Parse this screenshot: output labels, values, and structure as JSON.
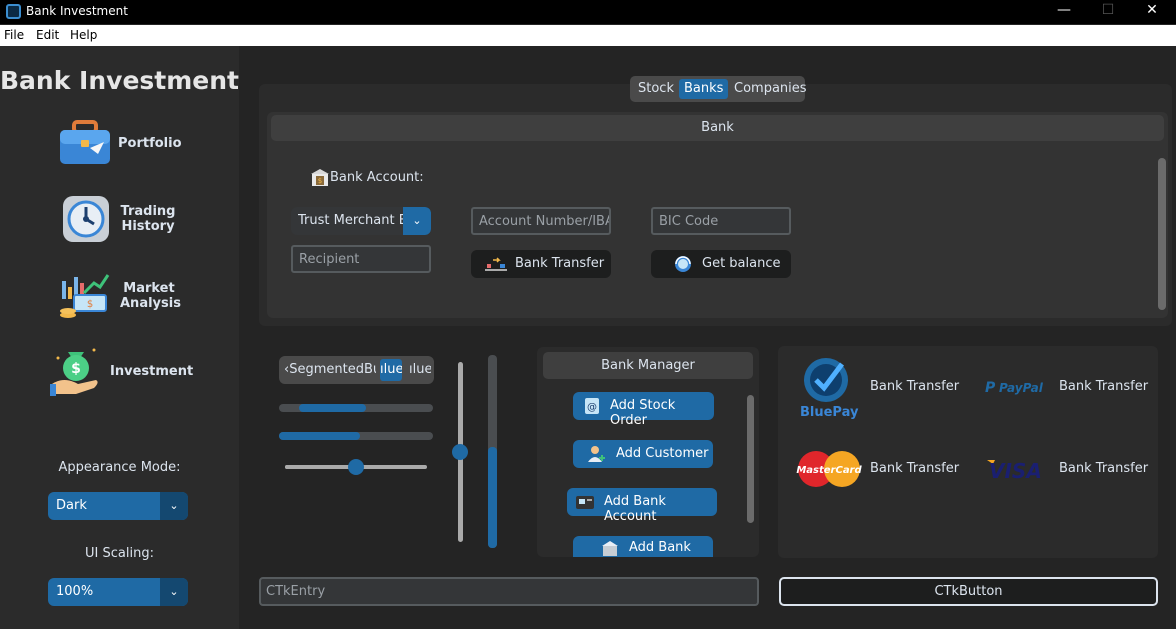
{
  "window": {
    "title": "Bank Investment",
    "controls": {
      "minimize": "—",
      "maximize": "☐",
      "close": "✕"
    }
  },
  "menu": [
    "File",
    "Edit",
    "Help"
  ],
  "sidebar": {
    "brand": "Bank Investment",
    "nav": [
      {
        "label_line1": "Portfolio",
        "label_line2": "",
        "icon": "briefcase-icon"
      },
      {
        "label_line1": "Trading",
        "label_line2": "History",
        "icon": "clock-history-icon"
      },
      {
        "label_line1": "Market",
        "label_line2": "Analysis",
        "icon": "market-chart-icon"
      },
      {
        "label_line1": "Investment",
        "label_line2": "",
        "icon": "money-bag-hand-icon"
      }
    ],
    "appearance_label": "Appearance Mode:",
    "appearance_value": "Dark",
    "scaling_label": "UI Scaling:",
    "scaling_value": "100%"
  },
  "tabs": [
    "Stock",
    "Banks",
    "Companies"
  ],
  "selected_tab": "Banks",
  "bank": {
    "header": "Bank",
    "account_label": "Bank Account:",
    "bank_select": "Trust Merchant Ba",
    "account_placeholder": "Account Number/IBAN",
    "bic_placeholder": "BIC Code",
    "recipient_placeholder": "Recipient",
    "transfer_button": "Bank Transfer",
    "balance_button": "Get balance"
  },
  "widgets": {
    "segmented_left": "‹SegmentedBut",
    "segmented_mid": "ılue",
    "segmented_right": "ılue",
    "progress1": 0.55,
    "progress2": 0.58,
    "slider_h": 0.5,
    "slider_v": 0.55,
    "progress_v": 0.53
  },
  "manager": {
    "header": "Bank Manager",
    "buttons": [
      "Add Stock Order",
      "Add Customer",
      "Add Bank Account",
      "Add Bank"
    ]
  },
  "payments": [
    {
      "brand": "BluePay",
      "label": "Bank Transfer"
    },
    {
      "brand": "PayPal",
      "label": "Bank Transfer"
    },
    {
      "brand": "MasterCard",
      "label": "Bank Transfer"
    },
    {
      "brand": "VISA",
      "label": "Bank Transfer"
    }
  ],
  "bottom": {
    "entry_placeholder": "CTkEntry",
    "button_label": "CTkButton"
  },
  "colors": {
    "accent": "#1f6aa5",
    "accent_dark": "#144870",
    "background": "#242424",
    "frame": "#2b2b2b"
  }
}
